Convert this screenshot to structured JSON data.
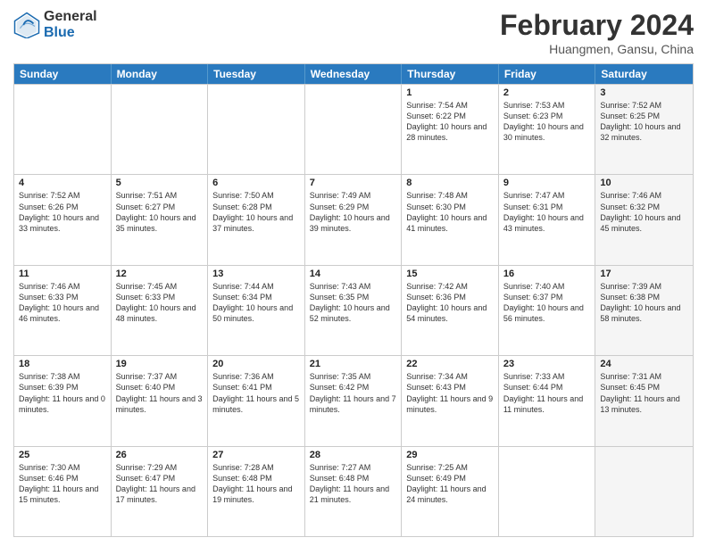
{
  "logo": {
    "general": "General",
    "blue": "Blue"
  },
  "title": {
    "month": "February 2024",
    "location": "Huangmen, Gansu, China"
  },
  "header_days": [
    "Sunday",
    "Monday",
    "Tuesday",
    "Wednesday",
    "Thursday",
    "Friday",
    "Saturday"
  ],
  "rows": [
    [
      {
        "day": "",
        "text": "",
        "shaded": false
      },
      {
        "day": "",
        "text": "",
        "shaded": false
      },
      {
        "day": "",
        "text": "",
        "shaded": false
      },
      {
        "day": "",
        "text": "",
        "shaded": false
      },
      {
        "day": "1",
        "text": "Sunrise: 7:54 AM\nSunset: 6:22 PM\nDaylight: 10 hours and 28 minutes.",
        "shaded": false
      },
      {
        "day": "2",
        "text": "Sunrise: 7:53 AM\nSunset: 6:23 PM\nDaylight: 10 hours and 30 minutes.",
        "shaded": false
      },
      {
        "day": "3",
        "text": "Sunrise: 7:52 AM\nSunset: 6:25 PM\nDaylight: 10 hours and 32 minutes.",
        "shaded": true
      }
    ],
    [
      {
        "day": "4",
        "text": "Sunrise: 7:52 AM\nSunset: 6:26 PM\nDaylight: 10 hours and 33 minutes.",
        "shaded": false
      },
      {
        "day": "5",
        "text": "Sunrise: 7:51 AM\nSunset: 6:27 PM\nDaylight: 10 hours and 35 minutes.",
        "shaded": false
      },
      {
        "day": "6",
        "text": "Sunrise: 7:50 AM\nSunset: 6:28 PM\nDaylight: 10 hours and 37 minutes.",
        "shaded": false
      },
      {
        "day": "7",
        "text": "Sunrise: 7:49 AM\nSunset: 6:29 PM\nDaylight: 10 hours and 39 minutes.",
        "shaded": false
      },
      {
        "day": "8",
        "text": "Sunrise: 7:48 AM\nSunset: 6:30 PM\nDaylight: 10 hours and 41 minutes.",
        "shaded": false
      },
      {
        "day": "9",
        "text": "Sunrise: 7:47 AM\nSunset: 6:31 PM\nDaylight: 10 hours and 43 minutes.",
        "shaded": false
      },
      {
        "day": "10",
        "text": "Sunrise: 7:46 AM\nSunset: 6:32 PM\nDaylight: 10 hours and 45 minutes.",
        "shaded": true
      }
    ],
    [
      {
        "day": "11",
        "text": "Sunrise: 7:46 AM\nSunset: 6:33 PM\nDaylight: 10 hours and 46 minutes.",
        "shaded": false
      },
      {
        "day": "12",
        "text": "Sunrise: 7:45 AM\nSunset: 6:33 PM\nDaylight: 10 hours and 48 minutes.",
        "shaded": false
      },
      {
        "day": "13",
        "text": "Sunrise: 7:44 AM\nSunset: 6:34 PM\nDaylight: 10 hours and 50 minutes.",
        "shaded": false
      },
      {
        "day": "14",
        "text": "Sunrise: 7:43 AM\nSunset: 6:35 PM\nDaylight: 10 hours and 52 minutes.",
        "shaded": false
      },
      {
        "day": "15",
        "text": "Sunrise: 7:42 AM\nSunset: 6:36 PM\nDaylight: 10 hours and 54 minutes.",
        "shaded": false
      },
      {
        "day": "16",
        "text": "Sunrise: 7:40 AM\nSunset: 6:37 PM\nDaylight: 10 hours and 56 minutes.",
        "shaded": false
      },
      {
        "day": "17",
        "text": "Sunrise: 7:39 AM\nSunset: 6:38 PM\nDaylight: 10 hours and 58 minutes.",
        "shaded": true
      }
    ],
    [
      {
        "day": "18",
        "text": "Sunrise: 7:38 AM\nSunset: 6:39 PM\nDaylight: 11 hours and 0 minutes.",
        "shaded": false
      },
      {
        "day": "19",
        "text": "Sunrise: 7:37 AM\nSunset: 6:40 PM\nDaylight: 11 hours and 3 minutes.",
        "shaded": false
      },
      {
        "day": "20",
        "text": "Sunrise: 7:36 AM\nSunset: 6:41 PM\nDaylight: 11 hours and 5 minutes.",
        "shaded": false
      },
      {
        "day": "21",
        "text": "Sunrise: 7:35 AM\nSunset: 6:42 PM\nDaylight: 11 hours and 7 minutes.",
        "shaded": false
      },
      {
        "day": "22",
        "text": "Sunrise: 7:34 AM\nSunset: 6:43 PM\nDaylight: 11 hours and 9 minutes.",
        "shaded": false
      },
      {
        "day": "23",
        "text": "Sunrise: 7:33 AM\nSunset: 6:44 PM\nDaylight: 11 hours and 11 minutes.",
        "shaded": false
      },
      {
        "day": "24",
        "text": "Sunrise: 7:31 AM\nSunset: 6:45 PM\nDaylight: 11 hours and 13 minutes.",
        "shaded": true
      }
    ],
    [
      {
        "day": "25",
        "text": "Sunrise: 7:30 AM\nSunset: 6:46 PM\nDaylight: 11 hours and 15 minutes.",
        "shaded": false
      },
      {
        "day": "26",
        "text": "Sunrise: 7:29 AM\nSunset: 6:47 PM\nDaylight: 11 hours and 17 minutes.",
        "shaded": false
      },
      {
        "day": "27",
        "text": "Sunrise: 7:28 AM\nSunset: 6:48 PM\nDaylight: 11 hours and 19 minutes.",
        "shaded": false
      },
      {
        "day": "28",
        "text": "Sunrise: 7:27 AM\nSunset: 6:48 PM\nDaylight: 11 hours and 21 minutes.",
        "shaded": false
      },
      {
        "day": "29",
        "text": "Sunrise: 7:25 AM\nSunset: 6:49 PM\nDaylight: 11 hours and 24 minutes.",
        "shaded": false
      },
      {
        "day": "",
        "text": "",
        "shaded": false
      },
      {
        "day": "",
        "text": "",
        "shaded": true
      }
    ]
  ]
}
